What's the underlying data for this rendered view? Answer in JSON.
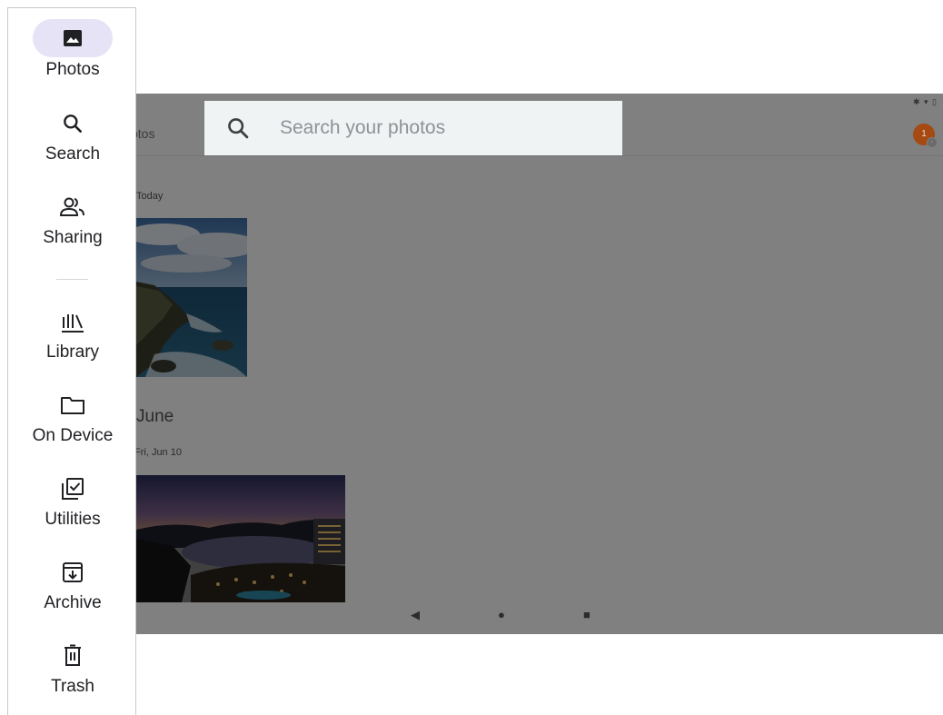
{
  "app": {
    "title_fragment": "otos",
    "avatar_initial": "1",
    "status_icons": "✱ ▾ ▯"
  },
  "search": {
    "placeholder": "Search your photos"
  },
  "timeline": {
    "sections": [
      {
        "label": "Today"
      },
      {
        "month": "June",
        "label": "Fri, Jun 10"
      }
    ]
  },
  "system_nav": {
    "back": "◀",
    "home": "●",
    "recents": "■"
  },
  "rail": {
    "items": [
      {
        "label": "Photos",
        "icon": "photos-icon",
        "active": true
      },
      {
        "label": "Search",
        "icon": "search-icon"
      },
      {
        "label": "Sharing",
        "icon": "people-icon"
      },
      {
        "label": "Library",
        "icon": "library-icon"
      },
      {
        "label": "On Device",
        "icon": "folder-icon"
      },
      {
        "label": "Utilities",
        "icon": "checklist-icon"
      },
      {
        "label": "Archive",
        "icon": "archive-icon"
      },
      {
        "label": "Trash",
        "icon": "trash-icon"
      }
    ]
  },
  "colors": {
    "rail_active_pill": "#e5e3f5",
    "scrim": "#808080",
    "search_bar": "#f0f3f4",
    "avatar": "#a44a12"
  }
}
